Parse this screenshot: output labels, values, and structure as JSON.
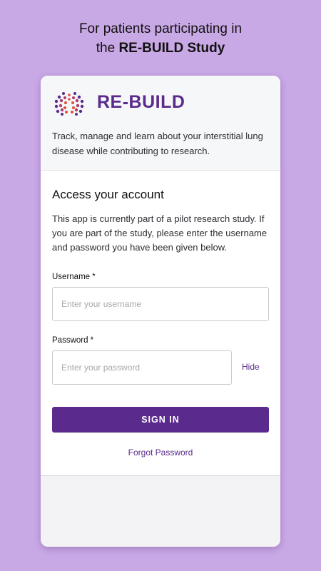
{
  "promo": {
    "line1": "For patients participating in",
    "line2_prefix": "the ",
    "line2_bold": "RE-BUILD Study"
  },
  "brand": {
    "name": "RE-BUILD",
    "logo_icon": "lungs-dots-icon",
    "color": "#5a2a8c"
  },
  "tagline": "Track, manage and learn about your interstitial lung disease while contributing to research.",
  "login": {
    "title": "Access your account",
    "intro": "This app is currently part of a pilot research study. If you are part of the study, please enter the username and password you have been given below.",
    "username_label": "Username *",
    "username_placeholder": "Enter your username",
    "password_label": "Password *",
    "password_placeholder": "Enter your password",
    "hide_label": "Hide",
    "signin_label": "SIGN IN",
    "forgot_label": "Forgot Password"
  },
  "colors": {
    "background": "#c9a8e6",
    "accent": "#5a2a8c"
  }
}
